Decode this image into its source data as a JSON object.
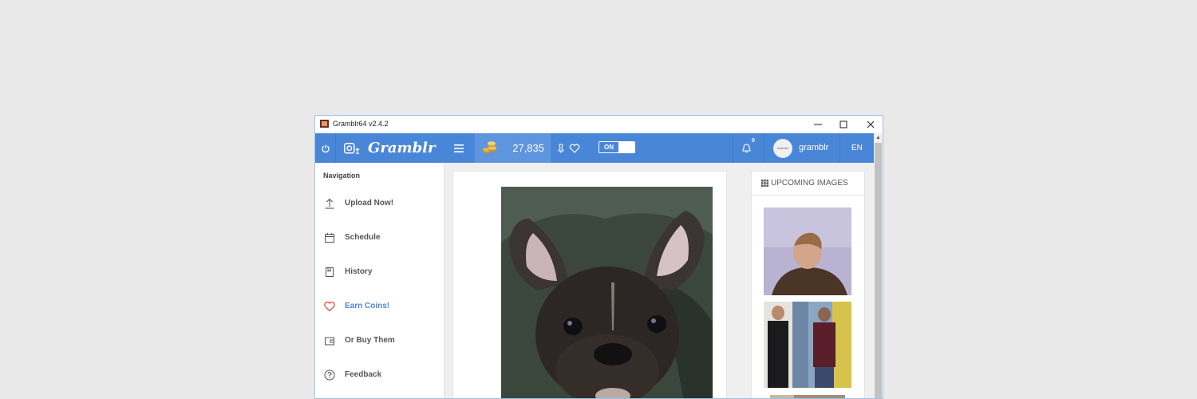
{
  "window": {
    "title": "Gramblr64 v2.4.2",
    "controls": [
      "minimize",
      "maximize",
      "close"
    ]
  },
  "appbar": {
    "power_icon": "power-icon",
    "upload_icon": "instagram-upload-icon",
    "brand": "Gramblr",
    "menu_icon": "hamburger-menu-icon",
    "coins": "27,835",
    "coin_icon": "coin-stack-icon",
    "like_icons": [
      "thumbs-icon",
      "heart-icon"
    ],
    "toggle_label": "ON",
    "notification_count": "0",
    "avatar_text": "Gramblr",
    "username": "gramblr",
    "language": "EN"
  },
  "sidebar": {
    "title": "Navigation",
    "items": [
      {
        "label": "Upload Now!",
        "icon": "upload-arrow-icon"
      },
      {
        "label": "Schedule",
        "icon": "calendar-icon"
      },
      {
        "label": "History",
        "icon": "history-book-icon"
      },
      {
        "label": "Earn Coins!",
        "icon": "heart-icon",
        "active": true
      },
      {
        "label": "Or Buy Them",
        "icon": "wallet-icon"
      },
      {
        "label": "Feedback",
        "icon": "question-circle-icon"
      }
    ]
  },
  "upcoming": {
    "title": "UPCOMING IMAGES",
    "icon": "grid-icon"
  },
  "colors": {
    "accent": "#4a86d8",
    "active_nav": "#4a86d8",
    "heart": "#e0413a"
  }
}
